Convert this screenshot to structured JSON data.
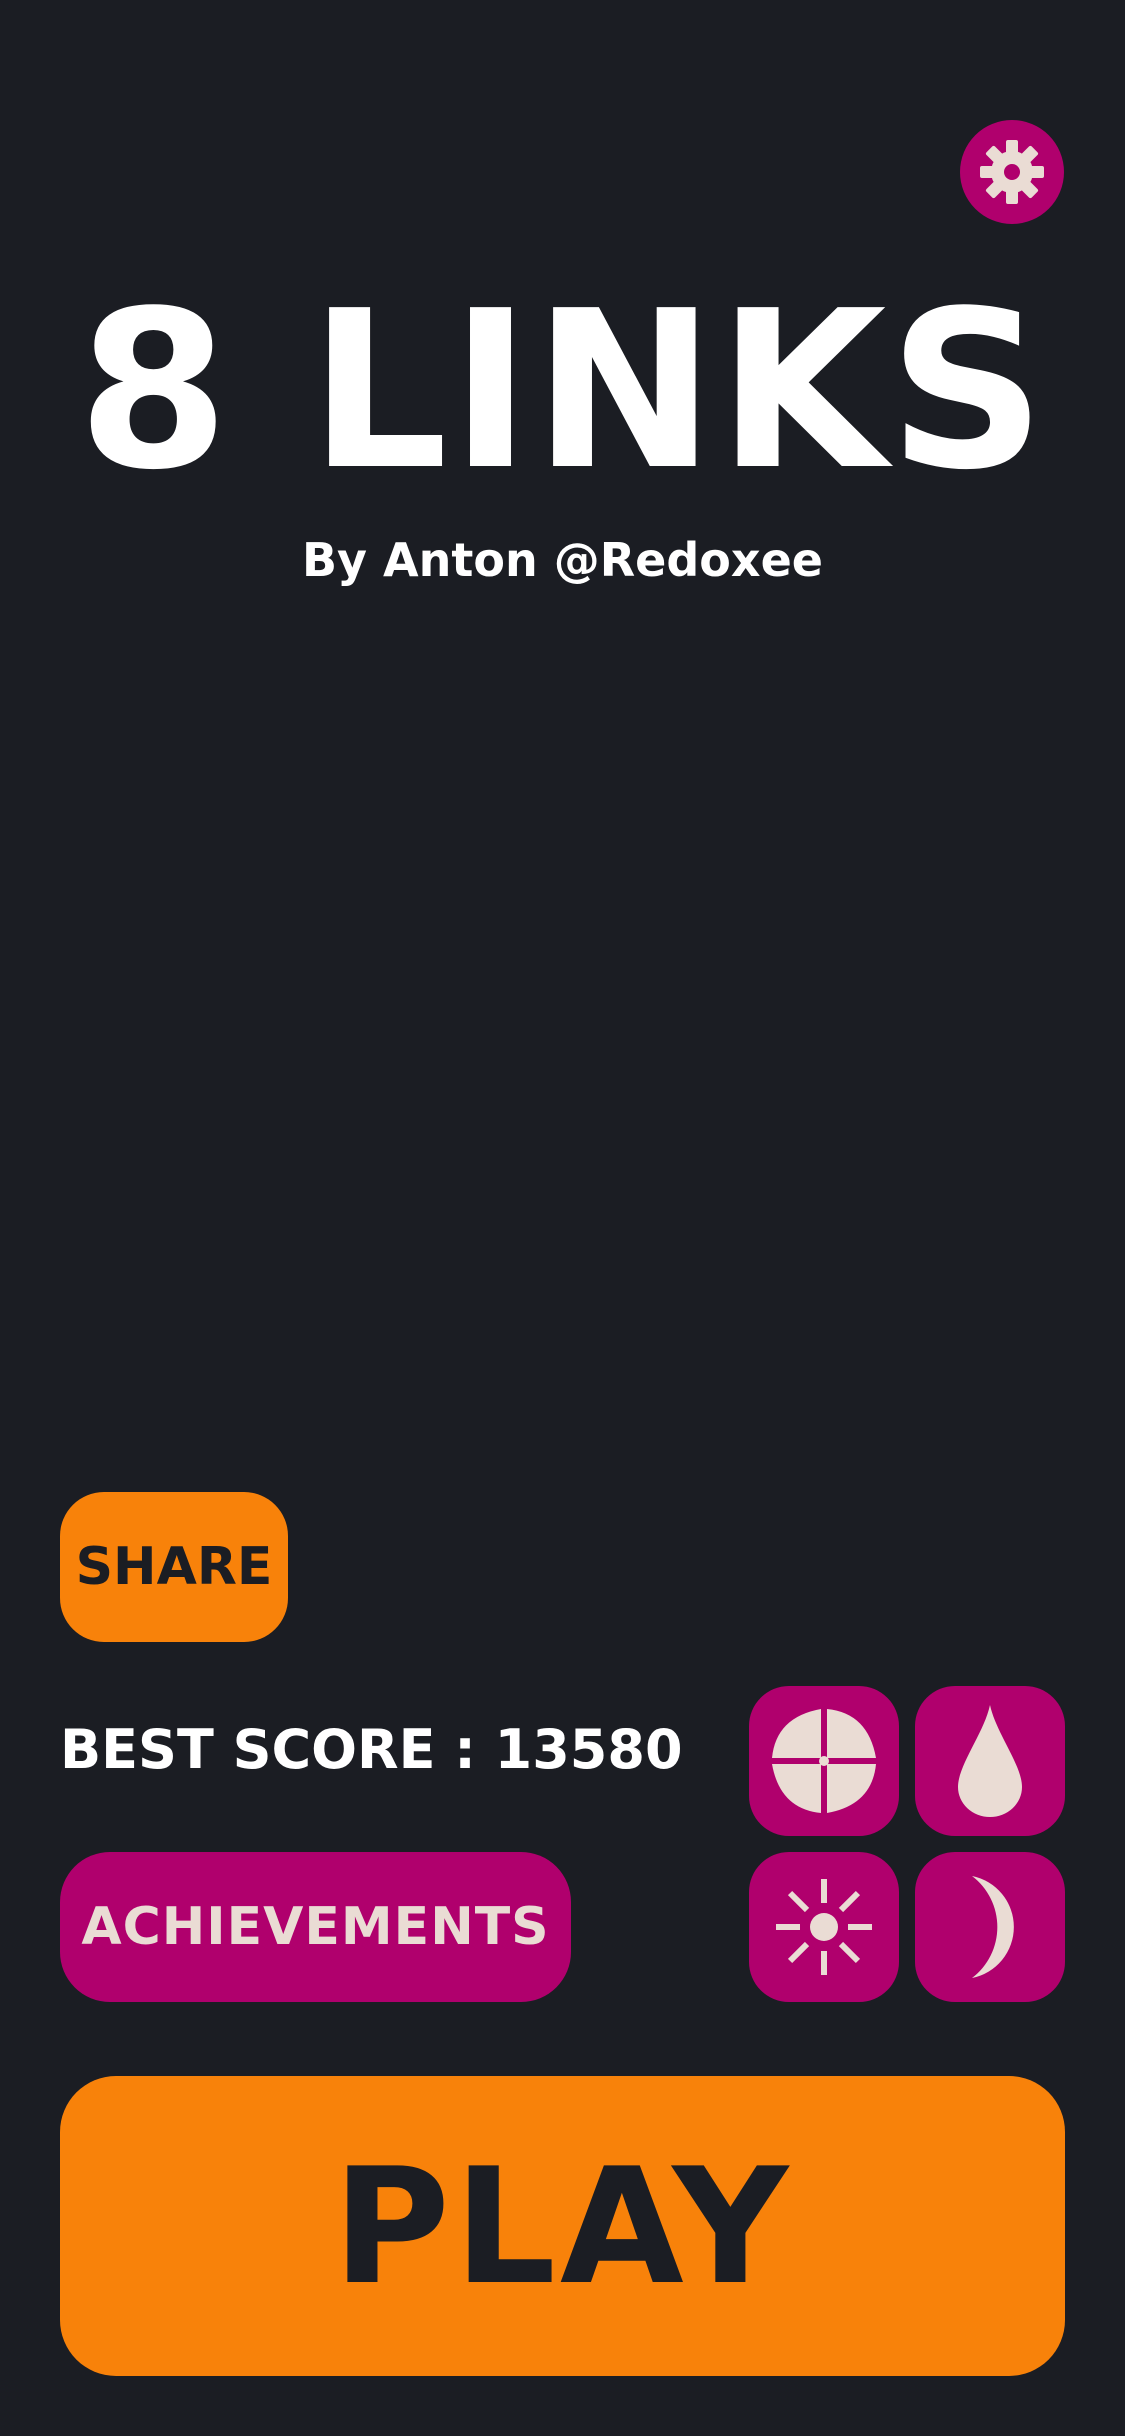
{
  "title": "8 LINKS",
  "subtitle": "By Anton @Redoxee",
  "share_label": "SHARE",
  "best_score": {
    "text": "BEST SCORE : 13580",
    "label": "BEST SCORE",
    "value": 13580
  },
  "achievements_label": "ACHIEVEMENTS",
  "play_label": "PLAY",
  "icons": {
    "settings": "gear-icon",
    "themes": [
      "pinwheel-icon",
      "water-drop-icon",
      "sun-icon",
      "crescent-moon-icon"
    ]
  },
  "colors": {
    "background": "#1b1d23",
    "accent_orange": "#f8820a",
    "accent_magenta": "#b0006d",
    "icon_cream": "#eadcd4",
    "text_white": "#ffffff",
    "text_dark": "#1b1d23"
  }
}
